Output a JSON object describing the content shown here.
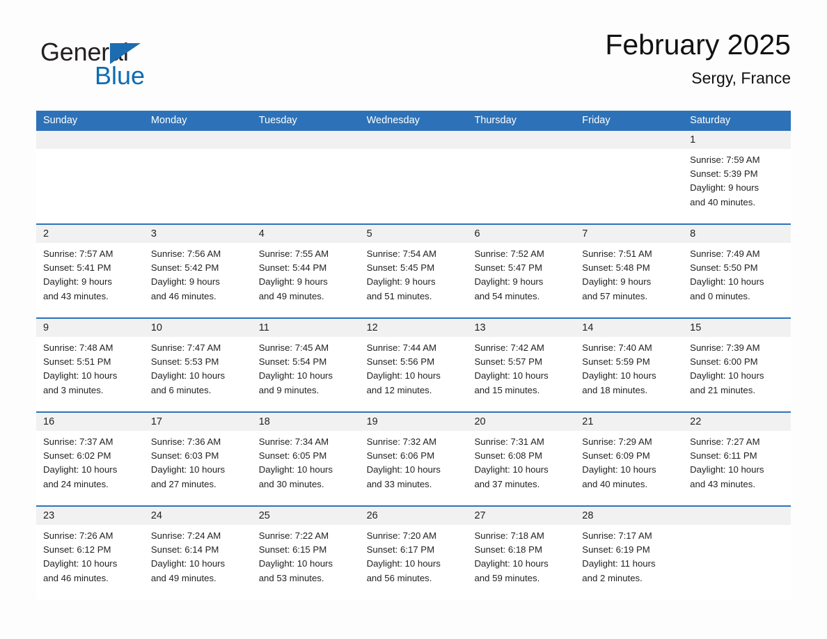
{
  "brand": {
    "name_part1": "General",
    "name_part2": "Blue",
    "accent_color": "#1b6cb0"
  },
  "header": {
    "month_title": "February 2025",
    "location": "Sergy, France"
  },
  "calendar": {
    "header_color": "#2d72b8",
    "daynum_band_color": "#f1f1f1",
    "weekdays": [
      "Sunday",
      "Monday",
      "Tuesday",
      "Wednesday",
      "Thursday",
      "Friday",
      "Saturday"
    ],
    "weeks": [
      [
        {
          "empty": true
        },
        {
          "empty": true
        },
        {
          "empty": true
        },
        {
          "empty": true
        },
        {
          "empty": true
        },
        {
          "empty": true
        },
        {
          "day": "1",
          "sunrise": "Sunrise: 7:59 AM",
          "sunset": "Sunset: 5:39 PM",
          "daylight1": "Daylight: 9 hours",
          "daylight2": "and 40 minutes."
        }
      ],
      [
        {
          "day": "2",
          "sunrise": "Sunrise: 7:57 AM",
          "sunset": "Sunset: 5:41 PM",
          "daylight1": "Daylight: 9 hours",
          "daylight2": "and 43 minutes."
        },
        {
          "day": "3",
          "sunrise": "Sunrise: 7:56 AM",
          "sunset": "Sunset: 5:42 PM",
          "daylight1": "Daylight: 9 hours",
          "daylight2": "and 46 minutes."
        },
        {
          "day": "4",
          "sunrise": "Sunrise: 7:55 AM",
          "sunset": "Sunset: 5:44 PM",
          "daylight1": "Daylight: 9 hours",
          "daylight2": "and 49 minutes."
        },
        {
          "day": "5",
          "sunrise": "Sunrise: 7:54 AM",
          "sunset": "Sunset: 5:45 PM",
          "daylight1": "Daylight: 9 hours",
          "daylight2": "and 51 minutes."
        },
        {
          "day": "6",
          "sunrise": "Sunrise: 7:52 AM",
          "sunset": "Sunset: 5:47 PM",
          "daylight1": "Daylight: 9 hours",
          "daylight2": "and 54 minutes."
        },
        {
          "day": "7",
          "sunrise": "Sunrise: 7:51 AM",
          "sunset": "Sunset: 5:48 PM",
          "daylight1": "Daylight: 9 hours",
          "daylight2": "and 57 minutes."
        },
        {
          "day": "8",
          "sunrise": "Sunrise: 7:49 AM",
          "sunset": "Sunset: 5:50 PM",
          "daylight1": "Daylight: 10 hours",
          "daylight2": "and 0 minutes."
        }
      ],
      [
        {
          "day": "9",
          "sunrise": "Sunrise: 7:48 AM",
          "sunset": "Sunset: 5:51 PM",
          "daylight1": "Daylight: 10 hours",
          "daylight2": "and 3 minutes."
        },
        {
          "day": "10",
          "sunrise": "Sunrise: 7:47 AM",
          "sunset": "Sunset: 5:53 PM",
          "daylight1": "Daylight: 10 hours",
          "daylight2": "and 6 minutes."
        },
        {
          "day": "11",
          "sunrise": "Sunrise: 7:45 AM",
          "sunset": "Sunset: 5:54 PM",
          "daylight1": "Daylight: 10 hours",
          "daylight2": "and 9 minutes."
        },
        {
          "day": "12",
          "sunrise": "Sunrise: 7:44 AM",
          "sunset": "Sunset: 5:56 PM",
          "daylight1": "Daylight: 10 hours",
          "daylight2": "and 12 minutes."
        },
        {
          "day": "13",
          "sunrise": "Sunrise: 7:42 AM",
          "sunset": "Sunset: 5:57 PM",
          "daylight1": "Daylight: 10 hours",
          "daylight2": "and 15 minutes."
        },
        {
          "day": "14",
          "sunrise": "Sunrise: 7:40 AM",
          "sunset": "Sunset: 5:59 PM",
          "daylight1": "Daylight: 10 hours",
          "daylight2": "and 18 minutes."
        },
        {
          "day": "15",
          "sunrise": "Sunrise: 7:39 AM",
          "sunset": "Sunset: 6:00 PM",
          "daylight1": "Daylight: 10 hours",
          "daylight2": "and 21 minutes."
        }
      ],
      [
        {
          "day": "16",
          "sunrise": "Sunrise: 7:37 AM",
          "sunset": "Sunset: 6:02 PM",
          "daylight1": "Daylight: 10 hours",
          "daylight2": "and 24 minutes."
        },
        {
          "day": "17",
          "sunrise": "Sunrise: 7:36 AM",
          "sunset": "Sunset: 6:03 PM",
          "daylight1": "Daylight: 10 hours",
          "daylight2": "and 27 minutes."
        },
        {
          "day": "18",
          "sunrise": "Sunrise: 7:34 AM",
          "sunset": "Sunset: 6:05 PM",
          "daylight1": "Daylight: 10 hours",
          "daylight2": "and 30 minutes."
        },
        {
          "day": "19",
          "sunrise": "Sunrise: 7:32 AM",
          "sunset": "Sunset: 6:06 PM",
          "daylight1": "Daylight: 10 hours",
          "daylight2": "and 33 minutes."
        },
        {
          "day": "20",
          "sunrise": "Sunrise: 7:31 AM",
          "sunset": "Sunset: 6:08 PM",
          "daylight1": "Daylight: 10 hours",
          "daylight2": "and 37 minutes."
        },
        {
          "day": "21",
          "sunrise": "Sunrise: 7:29 AM",
          "sunset": "Sunset: 6:09 PM",
          "daylight1": "Daylight: 10 hours",
          "daylight2": "and 40 minutes."
        },
        {
          "day": "22",
          "sunrise": "Sunrise: 7:27 AM",
          "sunset": "Sunset: 6:11 PM",
          "daylight1": "Daylight: 10 hours",
          "daylight2": "and 43 minutes."
        }
      ],
      [
        {
          "day": "23",
          "sunrise": "Sunrise: 7:26 AM",
          "sunset": "Sunset: 6:12 PM",
          "daylight1": "Daylight: 10 hours",
          "daylight2": "and 46 minutes."
        },
        {
          "day": "24",
          "sunrise": "Sunrise: 7:24 AM",
          "sunset": "Sunset: 6:14 PM",
          "daylight1": "Daylight: 10 hours",
          "daylight2": "and 49 minutes."
        },
        {
          "day": "25",
          "sunrise": "Sunrise: 7:22 AM",
          "sunset": "Sunset: 6:15 PM",
          "daylight1": "Daylight: 10 hours",
          "daylight2": "and 53 minutes."
        },
        {
          "day": "26",
          "sunrise": "Sunrise: 7:20 AM",
          "sunset": "Sunset: 6:17 PM",
          "daylight1": "Daylight: 10 hours",
          "daylight2": "and 56 minutes."
        },
        {
          "day": "27",
          "sunrise": "Sunrise: 7:18 AM",
          "sunset": "Sunset: 6:18 PM",
          "daylight1": "Daylight: 10 hours",
          "daylight2": "and 59 minutes."
        },
        {
          "day": "28",
          "sunrise": "Sunrise: 7:17 AM",
          "sunset": "Sunset: 6:19 PM",
          "daylight1": "Daylight: 11 hours",
          "daylight2": "and 2 minutes."
        },
        {
          "empty": true
        }
      ]
    ]
  }
}
